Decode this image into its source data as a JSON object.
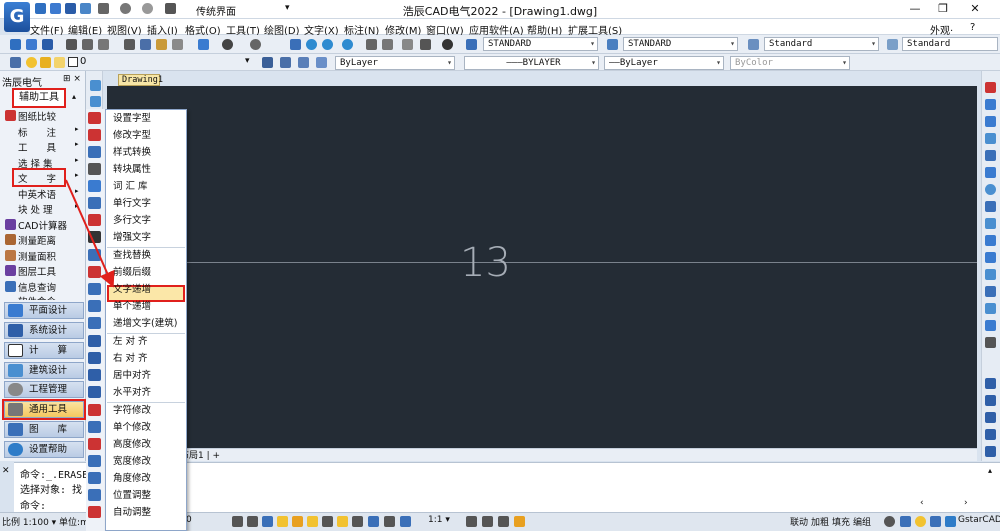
{
  "app": {
    "title": "浩辰CAD电气2022 - [Drawing1.dwg]",
    "workspace": "传统界面",
    "appearance": "外观·",
    "help": "?"
  },
  "menu": [
    "文件(F)",
    "编辑(E)",
    "视图(V)",
    "插入(I)",
    "格式(O)",
    "工具(T)",
    "绘图(D)",
    "文字(X)",
    "标注(N)",
    "修改(M)",
    "窗口(W)",
    "应用软件(A)",
    "帮助(H)",
    "扩展工具(S)"
  ],
  "toolbar": {
    "textstyle": "STANDARD",
    "dimstyle": "STANDARD",
    "tablestyle": "Standard",
    "mlstyle": "Standard",
    "layer": "0",
    "color": "ByLayer",
    "linetype": "BYLAYER",
    "lineweight": "ByLayer",
    "plotstyle": "ByColor"
  },
  "panel": {
    "title": "浩辰电气",
    "pin": "⊞ ×",
    "aux": "辅助工具",
    "items": [
      "图纸比较",
      "标　　注",
      "工　　具",
      "选 择 集",
      "文　　字",
      "中英术语",
      "块 处 理",
      "CAD计算器",
      "测量距离",
      "测量面积",
      "图层工具",
      "信息查询",
      "软件命令"
    ],
    "categories": [
      "平面设计",
      "系统设计",
      "计　　算",
      "建筑设计",
      "工程管理",
      "通用工具",
      "图　　库",
      "设置帮助"
    ]
  },
  "canvas": {
    "tab": "Drawing1",
    "number": "13",
    "layout_tab": "布局1",
    "plus": "+"
  },
  "popup": [
    "设置字型",
    "修改字型",
    "样式转换",
    "转块属性",
    "词 汇 库",
    "单行文字",
    "多行文字",
    "增强文字",
    "查找替换",
    "前缀后缀",
    "文字递增",
    "单个递增",
    "递增文字(建筑)",
    "左 对 齐",
    "右 对 齐",
    "居中对齐",
    "水平对齐",
    "字符修改",
    "单个修改",
    "高度修改",
    "宽度修改",
    "角度修改",
    "位置调整",
    "自动调整"
  ],
  "command": {
    "line1": "命令:_.ERASE",
    "line2": "选择对象: 找",
    "line3": "命令:"
  },
  "status": {
    "scale": "比例 1:100 ▾ 单位:mm",
    "zoom": "1:1 ▾",
    "right": [
      "联动",
      "加粗",
      "填充",
      "编组"
    ],
    "brand": "GstarCAD",
    "coords": "0"
  },
  "colors": {
    "accent": "#e0201c",
    "canvas": "#242c35",
    "highlight": "#fbe7a8"
  }
}
